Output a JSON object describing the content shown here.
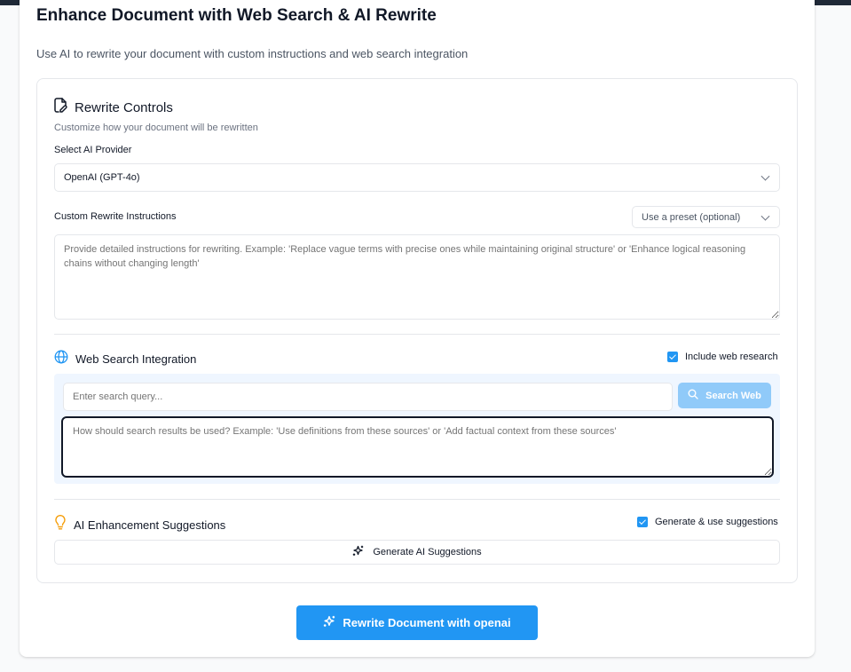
{
  "header": {
    "title": "Enhance Document with Web Search & AI Rewrite",
    "subtitle": "Use AI to rewrite your document with custom instructions and web search integration"
  },
  "rewrite_controls": {
    "title": "Rewrite Controls",
    "description": "Customize how your document will be rewritten",
    "provider_label": "Select AI Provider",
    "provider_value": "OpenAI (GPT-4o)",
    "instructions_label": "Custom Rewrite Instructions",
    "preset_value": "Use a preset (optional)",
    "instructions_placeholder": "Provide detailed instructions for rewriting. Example: 'Replace vague terms with precise ones while maintaining original structure' or 'Enhance logical reasoning chains without changing length'"
  },
  "web_search": {
    "title": "Web Search Integration",
    "include_label": "Include web research",
    "include_checked": true,
    "query_placeholder": "Enter search query...",
    "search_button": "Search Web",
    "usage_placeholder": "How should search results be used? Example: 'Use definitions from these sources' or 'Add factual context from these sources'"
  },
  "suggestions": {
    "title": "AI Enhancement Suggestions",
    "generate_use_label": "Generate & use suggestions",
    "generate_use_checked": true,
    "generate_button": "Generate AI Suggestions"
  },
  "primary_action": {
    "label": "Rewrite Document with openai"
  },
  "colors": {
    "accent": "#2196f3",
    "accent_disabled": "#90caf9",
    "search_bg": "#eff6ff",
    "bulb": "#f59e0b"
  }
}
